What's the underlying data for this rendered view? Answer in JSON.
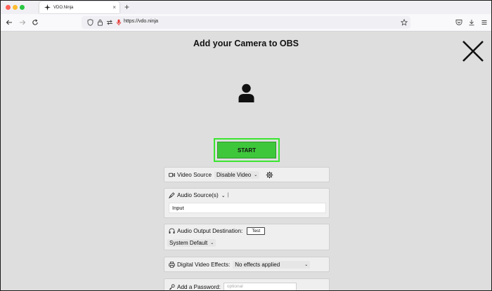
{
  "browser": {
    "tab_title": "VDO.Ninja",
    "tab_close": "×",
    "new_tab": "+",
    "url": "https://vdo.ninja"
  },
  "page": {
    "title": "Add your Camera to OBS",
    "start_label": "START",
    "accent_green": "#3ec73b",
    "highlight_green": "#39e62f"
  },
  "video_source": {
    "label": "Video Source",
    "value": "Disable Video"
  },
  "audio_sources": {
    "label": "Audio Source(s)",
    "value": "Input"
  },
  "audio_output": {
    "label": "Audio Output Destination:",
    "test_label": "Test",
    "value": "System Default"
  },
  "video_effects": {
    "label": "Digital Video Effects:",
    "value": "No effects applied"
  },
  "password": {
    "label": "Add a Password:",
    "placeholder": "optional"
  }
}
